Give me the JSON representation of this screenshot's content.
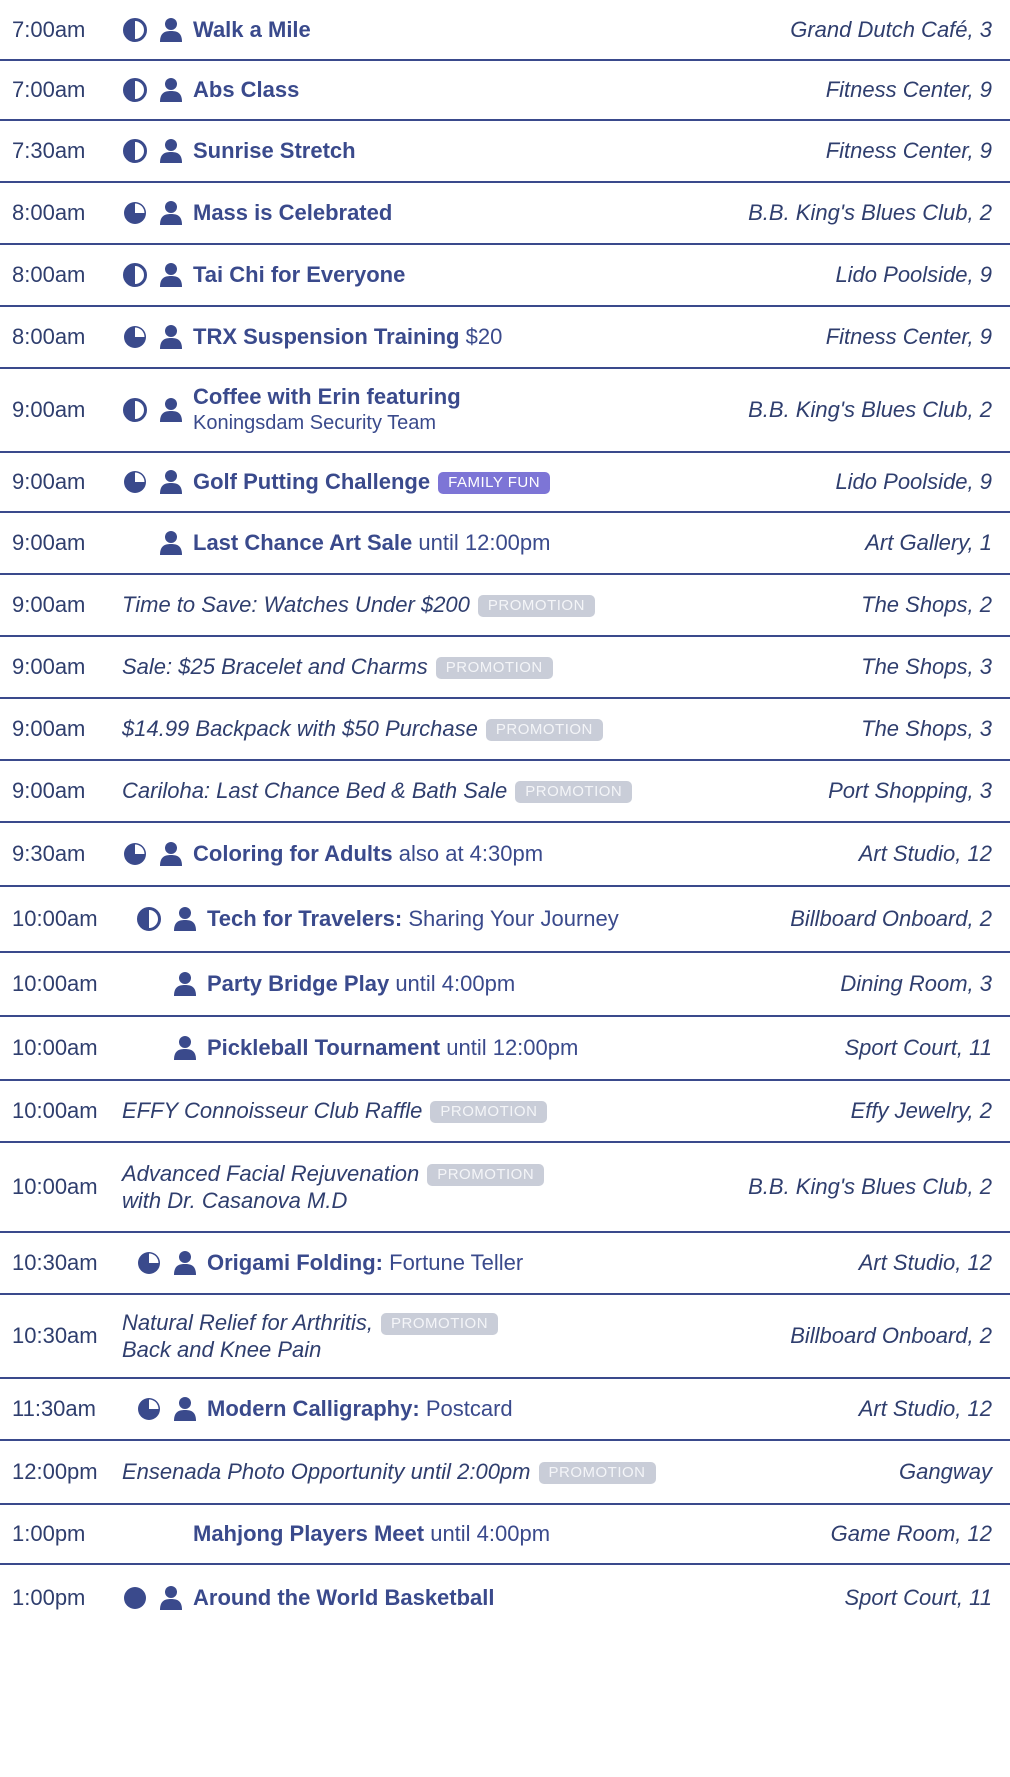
{
  "colors": {
    "text": "#2f3e6e",
    "accent": "#3a4a8c",
    "divider": "#3a4a8c",
    "promotion_badge": "#c9cdd8",
    "family_fun_badge": "#7d75d6"
  },
  "rows": [
    {
      "time": "7:00am",
      "intensity": "half",
      "person": true,
      "title": "Walk a Mile",
      "venue": "Grand Dutch Café, 3"
    },
    {
      "time": "7:00am",
      "intensity": "half",
      "person": true,
      "title": "Abs Class",
      "venue": "Fitness Center, 9"
    },
    {
      "time": "7:30am",
      "intensity": "half",
      "person": true,
      "title": "Sunrise Stretch",
      "venue": "Fitness Center, 9"
    },
    {
      "time": "8:00am",
      "intensity": "three-quarter",
      "person": true,
      "title": "Mass is Celebrated",
      "venue": "B.B. King's Blues Club, 2"
    },
    {
      "time": "8:00am",
      "intensity": "half",
      "person": true,
      "title": "Tai Chi for Everyone",
      "venue": "Lido Poolside, 9"
    },
    {
      "time": "8:00am",
      "intensity": "three-quarter",
      "person": true,
      "title": "TRX Suspension Training",
      "rest": "$20",
      "venue": "Fitness Center, 9"
    },
    {
      "time": "9:00am",
      "intensity": "half",
      "person": true,
      "title": "Coffee with Erin featuring",
      "line2": "Koningsdam Security Team",
      "venue": "B.B. King's Blues Club, 2"
    },
    {
      "time": "9:00am",
      "intensity": "three-quarter",
      "person": true,
      "title": "Golf Putting Challenge",
      "badge": "FAMILY FUN",
      "venue": "Lido Poolside, 9"
    },
    {
      "time": "9:00am",
      "person": true,
      "title": "Last Chance Art Sale",
      "rest": "until 12:00pm",
      "venue": "Art Gallery, 1"
    },
    {
      "time": "9:00am",
      "italic": "Time to Save: Watches Under $200",
      "badge": "PROMOTION",
      "venue": "The Shops, 2"
    },
    {
      "time": "9:00am",
      "italic": "Sale: $25 Bracelet and Charms",
      "badge": "PROMOTION",
      "venue": "The Shops, 3"
    },
    {
      "time": "9:00am",
      "italic": "$14.99 Backpack with $50 Purchase",
      "badge": "PROMOTION",
      "venue": "The Shops, 3"
    },
    {
      "time": "9:00am",
      "italic": "Cariloha: Last Chance Bed & Bath Sale",
      "badge": "PROMOTION",
      "venue": "Port Shopping, 3"
    },
    {
      "time": "9:30am",
      "intensity": "three-quarter",
      "person": true,
      "title": "Coloring for Adults",
      "rest": "also at 4:30pm",
      "venue": "Art Studio, 12"
    },
    {
      "time": "10:00am",
      "intensity": "half",
      "person": true,
      "title": "Tech for Travelers:",
      "rest": "Sharing Your Journey",
      "venue": "Billboard Onboard, 2"
    },
    {
      "time": "10:00am",
      "person": true,
      "title": "Party Bridge Play",
      "rest": "until 4:00pm",
      "venue": "Dining Room, 3"
    },
    {
      "time": "10:00am",
      "person": true,
      "title": "Pickleball Tournament",
      "rest": "until 12:00pm",
      "venue": "Sport Court, 11"
    },
    {
      "time": "10:00am",
      "italic": "EFFY Connoisseur Club Raffle",
      "badge": "PROMOTION",
      "venue": "Effy Jewelry, 2"
    },
    {
      "time": "10:00am",
      "italic": "Advanced Facial Rejuvenation",
      "italic2": "with Dr. Casanova M.D",
      "badge": "PROMOTION",
      "venue": "B.B. King's Blues Club, 2"
    },
    {
      "time": "10:30am",
      "intensity": "three-quarter",
      "person": true,
      "title": "Origami Folding:",
      "rest": "Fortune Teller",
      "venue": "Art Studio, 12"
    },
    {
      "time": "10:30am",
      "italic": "Natural Relief for Arthritis,",
      "italic2": "Back and Knee Pain",
      "badge": "PROMOTION",
      "venue": "Billboard Onboard, 2"
    },
    {
      "time": "11:30am",
      "intensity": "three-quarter",
      "person": true,
      "title": "Modern Calligraphy:",
      "rest": "Postcard",
      "venue": "Art Studio, 12"
    },
    {
      "time": "12:00pm",
      "italic": "Ensenada Photo Opportunity until 2:00pm",
      "badge": "PROMOTION",
      "venue": "Gangway"
    },
    {
      "time": "1:00pm",
      "title": "Mahjong Players Meet",
      "rest": "until 4:00pm",
      "venue": "Game Room, 12"
    },
    {
      "time": "1:00pm",
      "intensity": "full",
      "person": true,
      "title": "Around the World Basketball",
      "venue": "Sport Court, 11"
    }
  ]
}
